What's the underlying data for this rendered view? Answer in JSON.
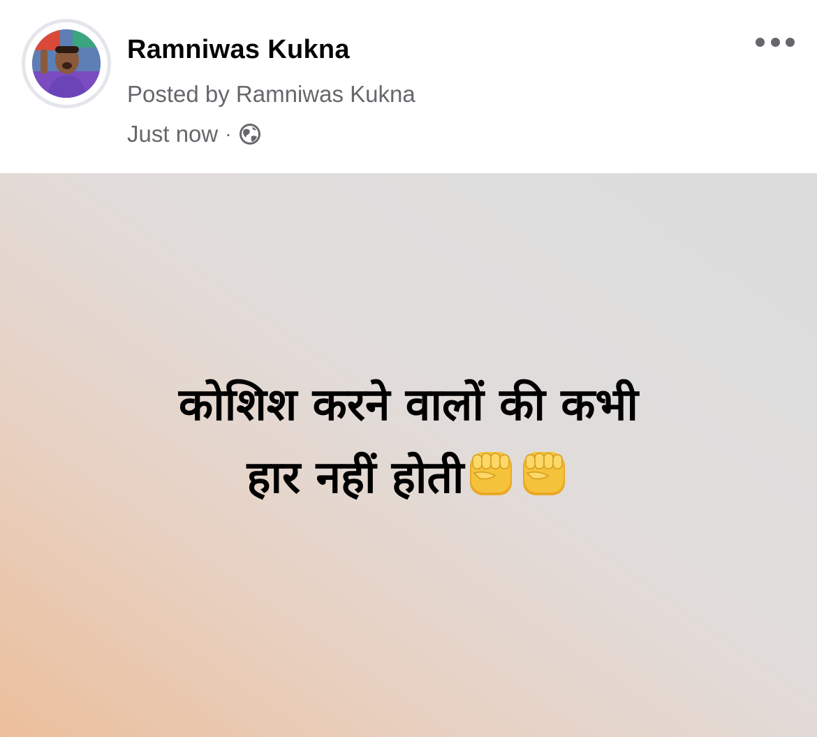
{
  "post": {
    "author_name": "Ramniwas Kukna",
    "posted_by": "Posted by Ramniwas Kukna",
    "timestamp": "Just now",
    "separator": "·",
    "privacy_icon": "globe-icon",
    "more_icon": "more-options-icon",
    "text_line_1": "कोशिश करने वालों की कभी",
    "text_line_2": "हार नहीं होती",
    "emoji": [
      "raised-fist-icon",
      "raised-fist-icon"
    ]
  },
  "colors": {
    "name": "#050505",
    "secondary_text": "#65676b",
    "body_text": "#000000",
    "background_warm": "#ecbf9c",
    "background_cool": "#dcdcdc",
    "emoji_yellow": "#f5c33b"
  }
}
